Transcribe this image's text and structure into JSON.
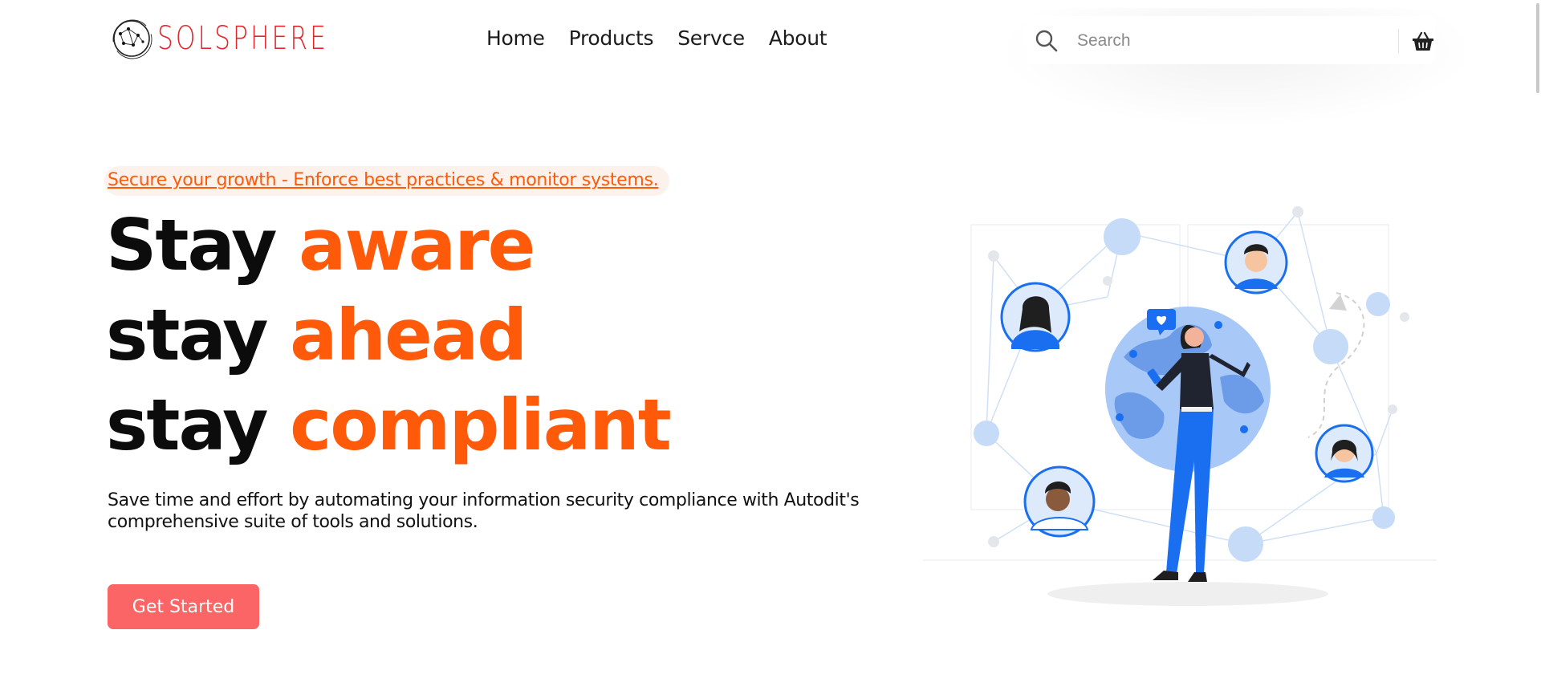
{
  "brand": {
    "name": "SOLSPHERE",
    "color": "#e1262c"
  },
  "nav": {
    "items": [
      {
        "label": "Home"
      },
      {
        "label": "Products"
      },
      {
        "label": "Servce"
      },
      {
        "label": "About"
      }
    ]
  },
  "search": {
    "placeholder": "Search",
    "value": "",
    "icon": "search-icon"
  },
  "cart": {
    "icon": "basket-icon"
  },
  "hero": {
    "tagline": "Secure your growth - Enforce best practices & monitor systems.",
    "lines": [
      {
        "prefix": "Stay",
        "accent": "aware"
      },
      {
        "prefix": "stay",
        "accent": "ahead"
      },
      {
        "prefix": "stay",
        "accent": "compliant"
      }
    ],
    "description": "Save time and effort by automating your information security compliance with Autodit's comprehensive suite of tools and solutions.",
    "cta_label": "Get Started",
    "illustration": "woman-with-globe-network-illustration"
  },
  "colors": {
    "accent": "#ff5a0a",
    "cta": "#fc6565",
    "text": "#0c0c0c",
    "illustration_blue": "#1a6ff0"
  }
}
